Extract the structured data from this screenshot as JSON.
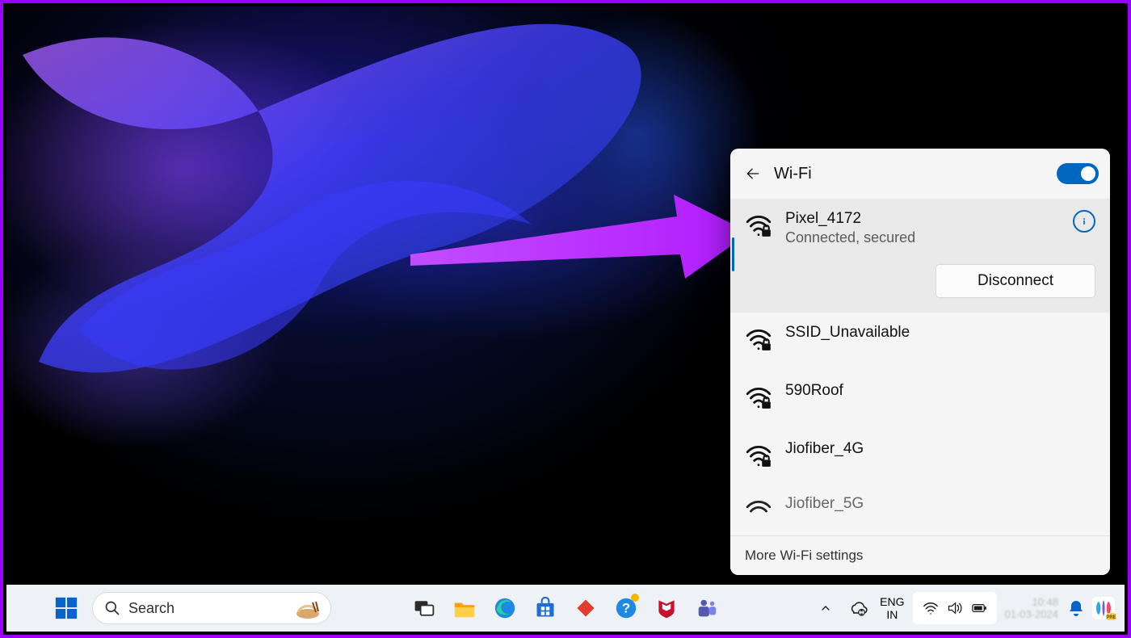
{
  "wifi": {
    "title": "Wi-Fi",
    "enabled": true,
    "networks": [
      {
        "name": "Pixel_4172",
        "status": "Connected, secured",
        "secured": true,
        "active": true
      },
      {
        "name": "SSID_Unavailable",
        "secured": true
      },
      {
        "name": "590Roof",
        "secured": true
      },
      {
        "name": "Jiofiber_4G",
        "secured": true
      },
      {
        "name": "Jiofiber_5G",
        "secured": true,
        "partial": true
      }
    ],
    "disconnect_label": "Disconnect",
    "footer_label": "More Wi-Fi settings"
  },
  "taskbar": {
    "search_placeholder": "Search",
    "apps": [
      {
        "id": "task-view",
        "label": "Task View"
      },
      {
        "id": "file-explorer",
        "label": "File Explorer"
      },
      {
        "id": "edge",
        "label": "Microsoft Edge"
      },
      {
        "id": "ms-store",
        "label": "Microsoft Store"
      },
      {
        "id": "diamond-app",
        "label": "Diamond App"
      },
      {
        "id": "get-help",
        "label": "Get Help",
        "badge": true
      },
      {
        "id": "mcafee",
        "label": "McAfee"
      },
      {
        "id": "teams",
        "label": "Microsoft Teams"
      }
    ],
    "language": {
      "line1": "ENG",
      "line2": "IN"
    },
    "clock": {
      "line1": "10:48",
      "line2": "01-03-2024"
    }
  }
}
